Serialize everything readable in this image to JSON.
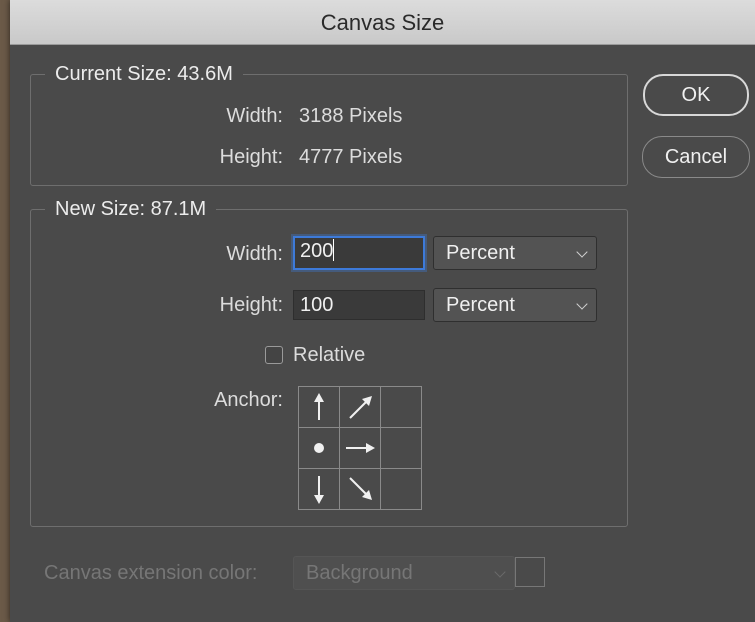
{
  "window": {
    "title": "Canvas Size"
  },
  "current_size": {
    "legend": "Current Size: 43.6M",
    "width_label": "Width:",
    "width_value": "3188 Pixels",
    "height_label": "Height:",
    "height_value": "4777 Pixels"
  },
  "new_size": {
    "legend": "New Size: 87.1M",
    "width_label": "Width:",
    "width_value": "200",
    "width_unit": "Percent",
    "height_label": "Height:",
    "height_value": "100",
    "height_unit": "Percent",
    "relative_label": "Relative",
    "relative_checked": false,
    "anchor_label": "Anchor:",
    "anchor_cells": [
      "arrow-up-icon",
      "arrow-up-right-icon",
      "",
      "anchor-dot-icon",
      "arrow-right-icon",
      "",
      "arrow-down-icon",
      "arrow-down-right-icon",
      ""
    ]
  },
  "extension": {
    "label": "Canvas extension color:",
    "value": "Background"
  },
  "buttons": {
    "ok": "OK",
    "cancel": "Cancel"
  },
  "colors": {
    "focus": "#3d7ad9",
    "dialog_bg": "#4a4a4a",
    "titlebar": "#d4d4d4"
  }
}
